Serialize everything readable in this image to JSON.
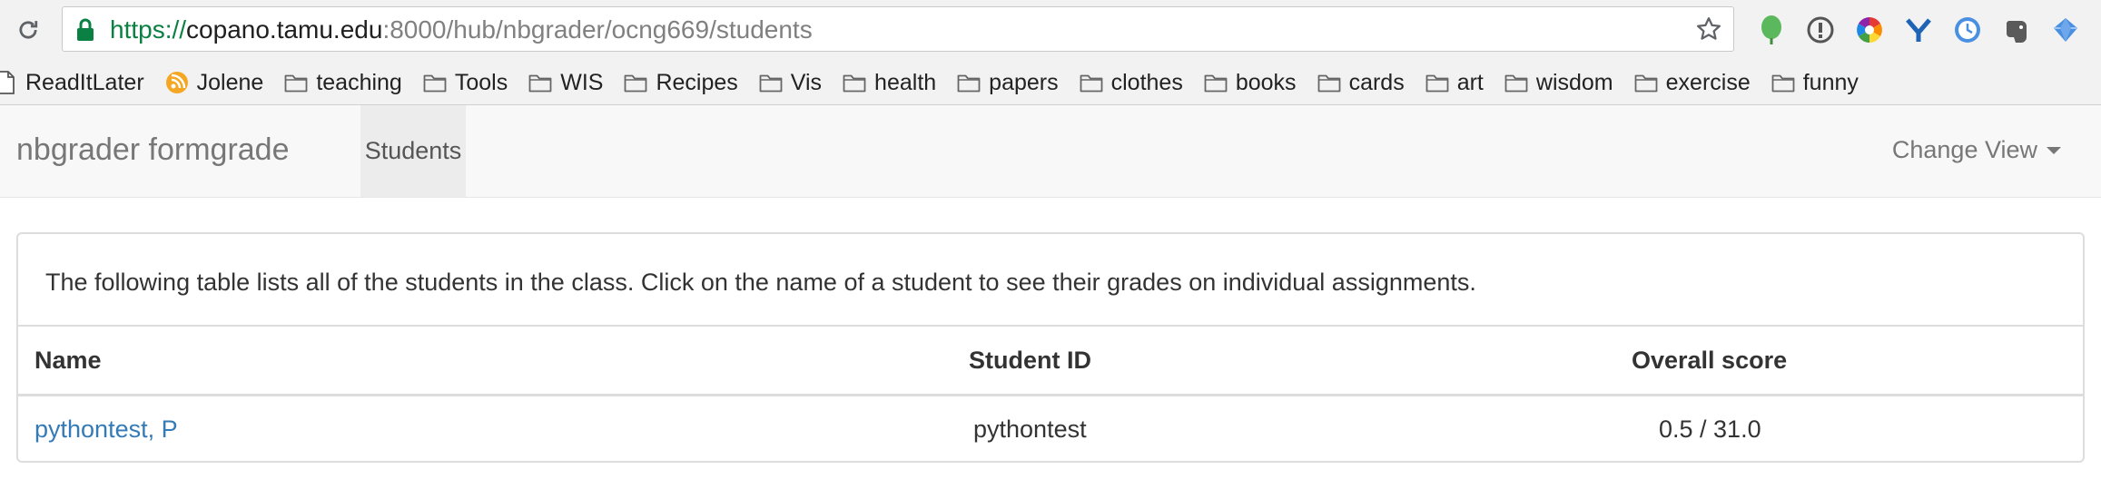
{
  "browser": {
    "url": {
      "scheme": "https://",
      "host": "copano.tamu.edu",
      "rest": ":8000/hub/nbgrader/ocng669/students"
    },
    "icons": {
      "reload": "reload-icon",
      "lock": "lock-icon",
      "star": "bookmark-star-icon",
      "extensions": [
        "green-leaf-icon",
        "info-circle-icon",
        "color-wheel-icon",
        "y-logo-icon",
        "clock-icon",
        "elephant-icon",
        "blue-diamond-icon"
      ]
    },
    "bookmarks": [
      {
        "label": "ReadItLater",
        "icon": "page-icon"
      },
      {
        "label": "Jolene",
        "icon": "rss-icon"
      },
      {
        "label": "teaching",
        "icon": "folder-icon"
      },
      {
        "label": "Tools",
        "icon": "folder-icon"
      },
      {
        "label": "WIS",
        "icon": "folder-icon"
      },
      {
        "label": "Recipes",
        "icon": "folder-icon"
      },
      {
        "label": "Vis",
        "icon": "folder-icon"
      },
      {
        "label": "health",
        "icon": "folder-icon"
      },
      {
        "label": "papers",
        "icon": "folder-icon"
      },
      {
        "label": "clothes",
        "icon": "folder-icon"
      },
      {
        "label": "books",
        "icon": "folder-icon"
      },
      {
        "label": "cards",
        "icon": "folder-icon"
      },
      {
        "label": "art",
        "icon": "folder-icon"
      },
      {
        "label": "wisdom",
        "icon": "folder-icon"
      },
      {
        "label": "exercise",
        "icon": "folder-icon"
      },
      {
        "label": "funny",
        "icon": "folder-icon"
      }
    ]
  },
  "navbar": {
    "brand": "nbgrader formgrade",
    "active_item": "Students",
    "change_view": "Change View"
  },
  "panel": {
    "intro": "The following table lists all of the students in the class. Click on the name of a student to see their grades on individual assignments.",
    "columns": [
      "Name",
      "Student ID",
      "Overall score"
    ],
    "rows": [
      {
        "name": "pythontest, P",
        "student_id": "pythontest",
        "score": "0.5 / 31.0"
      }
    ]
  },
  "colors": {
    "link": "#337ab7",
    "secure_green": "#0b8043",
    "navbar_bg": "#f8f8f8",
    "border": "#dddddd"
  }
}
